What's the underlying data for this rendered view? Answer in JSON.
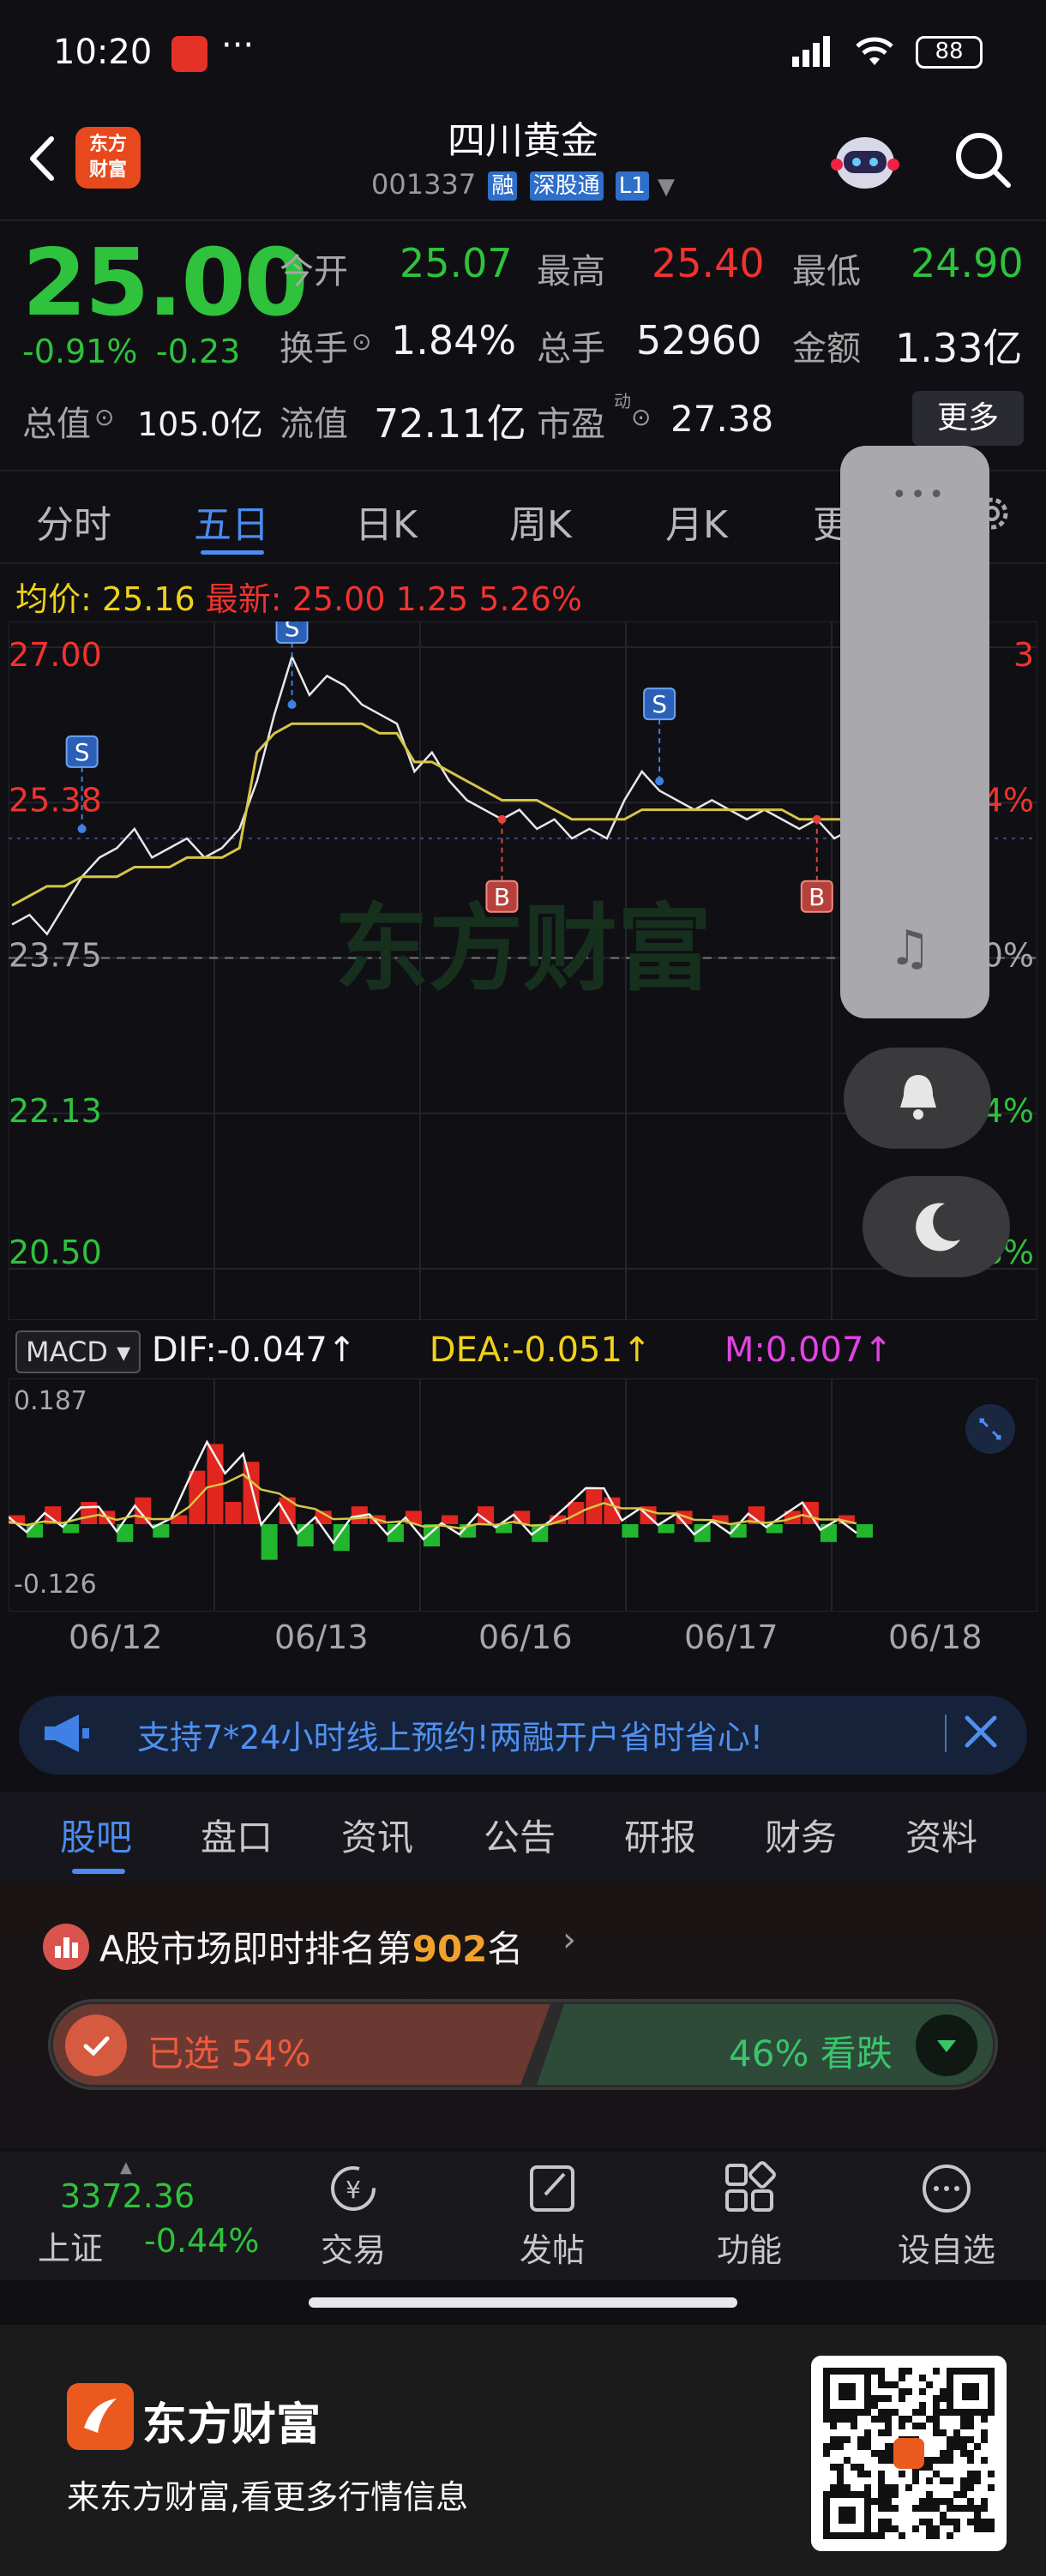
{
  "status_bar": {
    "time": "10:20",
    "dots": "···",
    "battery": "88"
  },
  "header": {
    "brand_logo": "东方\n财富",
    "stock_name": "四川黄金",
    "stock_code": "001337",
    "tags": [
      "融",
      "深股通",
      "L1"
    ]
  },
  "quote": {
    "price": "25.00",
    "change": "-0.91%",
    "change_abs": "-0.23",
    "open_label": "今开",
    "open": "25.07",
    "high_label": "最高",
    "high": "25.40",
    "low_label": "最低",
    "low": "24.90",
    "turnover_label": "换手",
    "turnover": "1.84%",
    "volume_label": "总手",
    "volume": "52960",
    "amount_label": "金额",
    "amount": "1.33亿",
    "total_value_label": "总值",
    "total_value": "105.0亿",
    "float_value_label": "流值",
    "float_value": "72.11亿",
    "pe_label": "市盈",
    "pe_superscript": "动",
    "pe": "27.38",
    "more_label": "更多"
  },
  "period_tabs": [
    "分时",
    "五日",
    "日K",
    "周K",
    "月K",
    "更"
  ],
  "active_period": "五日",
  "chart_info": {
    "avg_label": "均价:",
    "avg": "25.16",
    "latest_label": "最新:",
    "latest": "25.00",
    "latest_change": "1.25",
    "latest_pct": "5.26%"
  },
  "chart_data": {
    "type": "line",
    "left_ticks": [
      "27.00",
      "25.38",
      "23.75",
      "22.13",
      "20.50"
    ],
    "right_ticks": [
      "3",
      "4%",
      "0%",
      "-6.84%",
      "-13.68%"
    ],
    "x_labels": [
      "06/12",
      "06/13",
      "06/16",
      "06/17",
      "06/18"
    ],
    "watermark": "东方财富",
    "ylim": [
      20.5,
      27.0
    ],
    "reference_price": 23.75,
    "series": [
      {
        "values": [
          24.1,
          24.2,
          24.0,
          24.3,
          24.6,
          24.8,
          24.9,
          25.1,
          24.8,
          24.9,
          25.0,
          24.8,
          24.9,
          25.1,
          25.6,
          26.3,
          26.9,
          26.5,
          26.7,
          26.6,
          26.4,
          26.3,
          26.2,
          25.7,
          25.9,
          25.6,
          25.4,
          25.3,
          25.2,
          25.3,
          25.1,
          25.2,
          25.0,
          25.1,
          25.0,
          25.4,
          25.7,
          25.5,
          25.4,
          25.3,
          25.4,
          25.3,
          25.2,
          25.3,
          25.2,
          25.1,
          25.2,
          25.0,
          25.1,
          25.3
        ]
      },
      {
        "values": [
          24.3,
          24.4,
          24.5,
          24.5,
          24.6,
          24.6,
          24.6,
          24.7,
          24.7,
          24.7,
          24.8,
          24.8,
          24.8,
          24.9,
          25.9,
          26.1,
          26.2,
          26.2,
          26.2,
          26.2,
          26.2,
          26.1,
          26.1,
          25.8,
          25.8,
          25.7,
          25.6,
          25.5,
          25.4,
          25.4,
          25.4,
          25.3,
          25.2,
          25.2,
          25.2,
          25.2,
          25.3,
          25.3,
          25.3,
          25.3,
          25.3,
          25.3,
          25.3,
          25.3,
          25.3,
          25.2,
          25.2,
          25.2,
          25.2,
          25.2
        ]
      }
    ],
    "signals": [
      {
        "label": "S",
        "x": 4,
        "y": 25.1
      },
      {
        "label": "S",
        "x": 16,
        "y": 26.4
      },
      {
        "label": "B",
        "x": 28,
        "y": 25.2
      },
      {
        "label": "S",
        "x": 37,
        "y": 25.6
      },
      {
        "label": "B",
        "x": 46,
        "y": 25.2
      },
      {
        "label": "S",
        "x": 49,
        "y": 25.3
      }
    ],
    "macd": {
      "name": "MACD",
      "dif_label": "DIF:",
      "dif": "-0.047",
      "dea_label": "DEA:",
      "dea": "-0.051",
      "m_label": "M:",
      "m": "0.007",
      "top_tick": "0.187",
      "bottom_tick": "-0.126",
      "hist": [
        0.02,
        -0.03,
        0.04,
        -0.02,
        0.05,
        0.03,
        -0.04,
        0.06,
        -0.03,
        0.02,
        0.12,
        0.18,
        0.05,
        0.14,
        -0.08,
        0.06,
        -0.05,
        0.03,
        -0.06,
        0.04,
        0.02,
        -0.04,
        0.03,
        -0.05,
        0.02,
        -0.03,
        0.04,
        -0.02,
        0.03,
        -0.04,
        0.02,
        0.05,
        0.08,
        0.06,
        -0.03,
        0.04,
        -0.02,
        0.03,
        -0.04,
        0.02,
        -0.03,
        0.04,
        -0.02,
        0.03,
        0.05,
        -0.04,
        0.02,
        -0.03
      ]
    }
  },
  "promo_banner": {
    "text": "支持7*24小时线上预约!两融开户省时省心!"
  },
  "lower_tabs": [
    "股吧",
    "盘口",
    "资讯",
    "公告",
    "研报",
    "财务",
    "资料"
  ],
  "active_lower_tab": "股吧",
  "forum": {
    "rank_prefix": "A股市场即时排名第",
    "rank_num": "902",
    "rank_suffix": "名",
    "vote_up": "已选 54%",
    "vote_down": "46% 看跌"
  },
  "toolbar": {
    "index_value": "3372.36",
    "index_name": "上证",
    "index_pct": "-0.44%",
    "items": [
      "交易",
      "发帖",
      "功能",
      "设自选"
    ]
  },
  "footer": {
    "brand": "东方财富",
    "slogan": "来东方财富,看更多行情信息"
  },
  "colors": {
    "up": "#f0332e",
    "down": "#2fc23c",
    "accent": "#4b8cf0",
    "avg_line": "#d6c547"
  }
}
